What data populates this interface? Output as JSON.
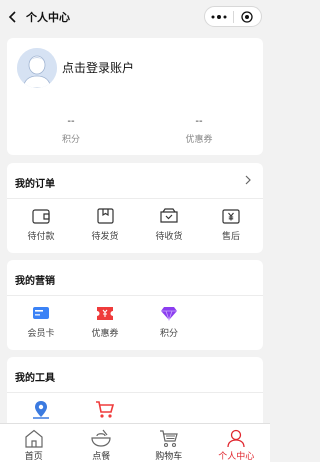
{
  "header": {
    "title": "个人中心"
  },
  "profile": {
    "login_text": "点击登录账户",
    "points_value": "--",
    "points_label": "积分",
    "coupon_value": "--",
    "coupon_label": "优惠券"
  },
  "orders": {
    "title": "我的订单",
    "items": [
      {
        "label": "待付款",
        "icon": "wallet-icon"
      },
      {
        "label": "待发货",
        "icon": "package-icon"
      },
      {
        "label": "待收货",
        "icon": "receive-box-icon"
      },
      {
        "label": "售后",
        "icon": "yen-ticket-icon"
      }
    ]
  },
  "marketing": {
    "title": "我的营销",
    "items": [
      {
        "label": "会员卡",
        "icon": "member-card-icon",
        "color": "#3b82f6"
      },
      {
        "label": "优惠券",
        "icon": "coupon-icon",
        "color": "#ef3b3b"
      },
      {
        "label": "积分",
        "icon": "diamond-icon",
        "color": "#8b3df0"
      }
    ]
  },
  "tools": {
    "title": "我的工具",
    "items": [
      {
        "icon": "location-icon",
        "color": "#3b7ae0"
      },
      {
        "icon": "cart-icon",
        "color": "#ef3b3b"
      }
    ]
  },
  "tabbar": {
    "active_color": "#e0262e",
    "items": [
      {
        "label": "首页",
        "icon": "home-icon"
      },
      {
        "label": "点餐",
        "icon": "bowl-icon"
      },
      {
        "label": "购物车",
        "icon": "shopping-cart-icon"
      },
      {
        "label": "个人中心",
        "icon": "user-icon",
        "active": true
      }
    ]
  }
}
